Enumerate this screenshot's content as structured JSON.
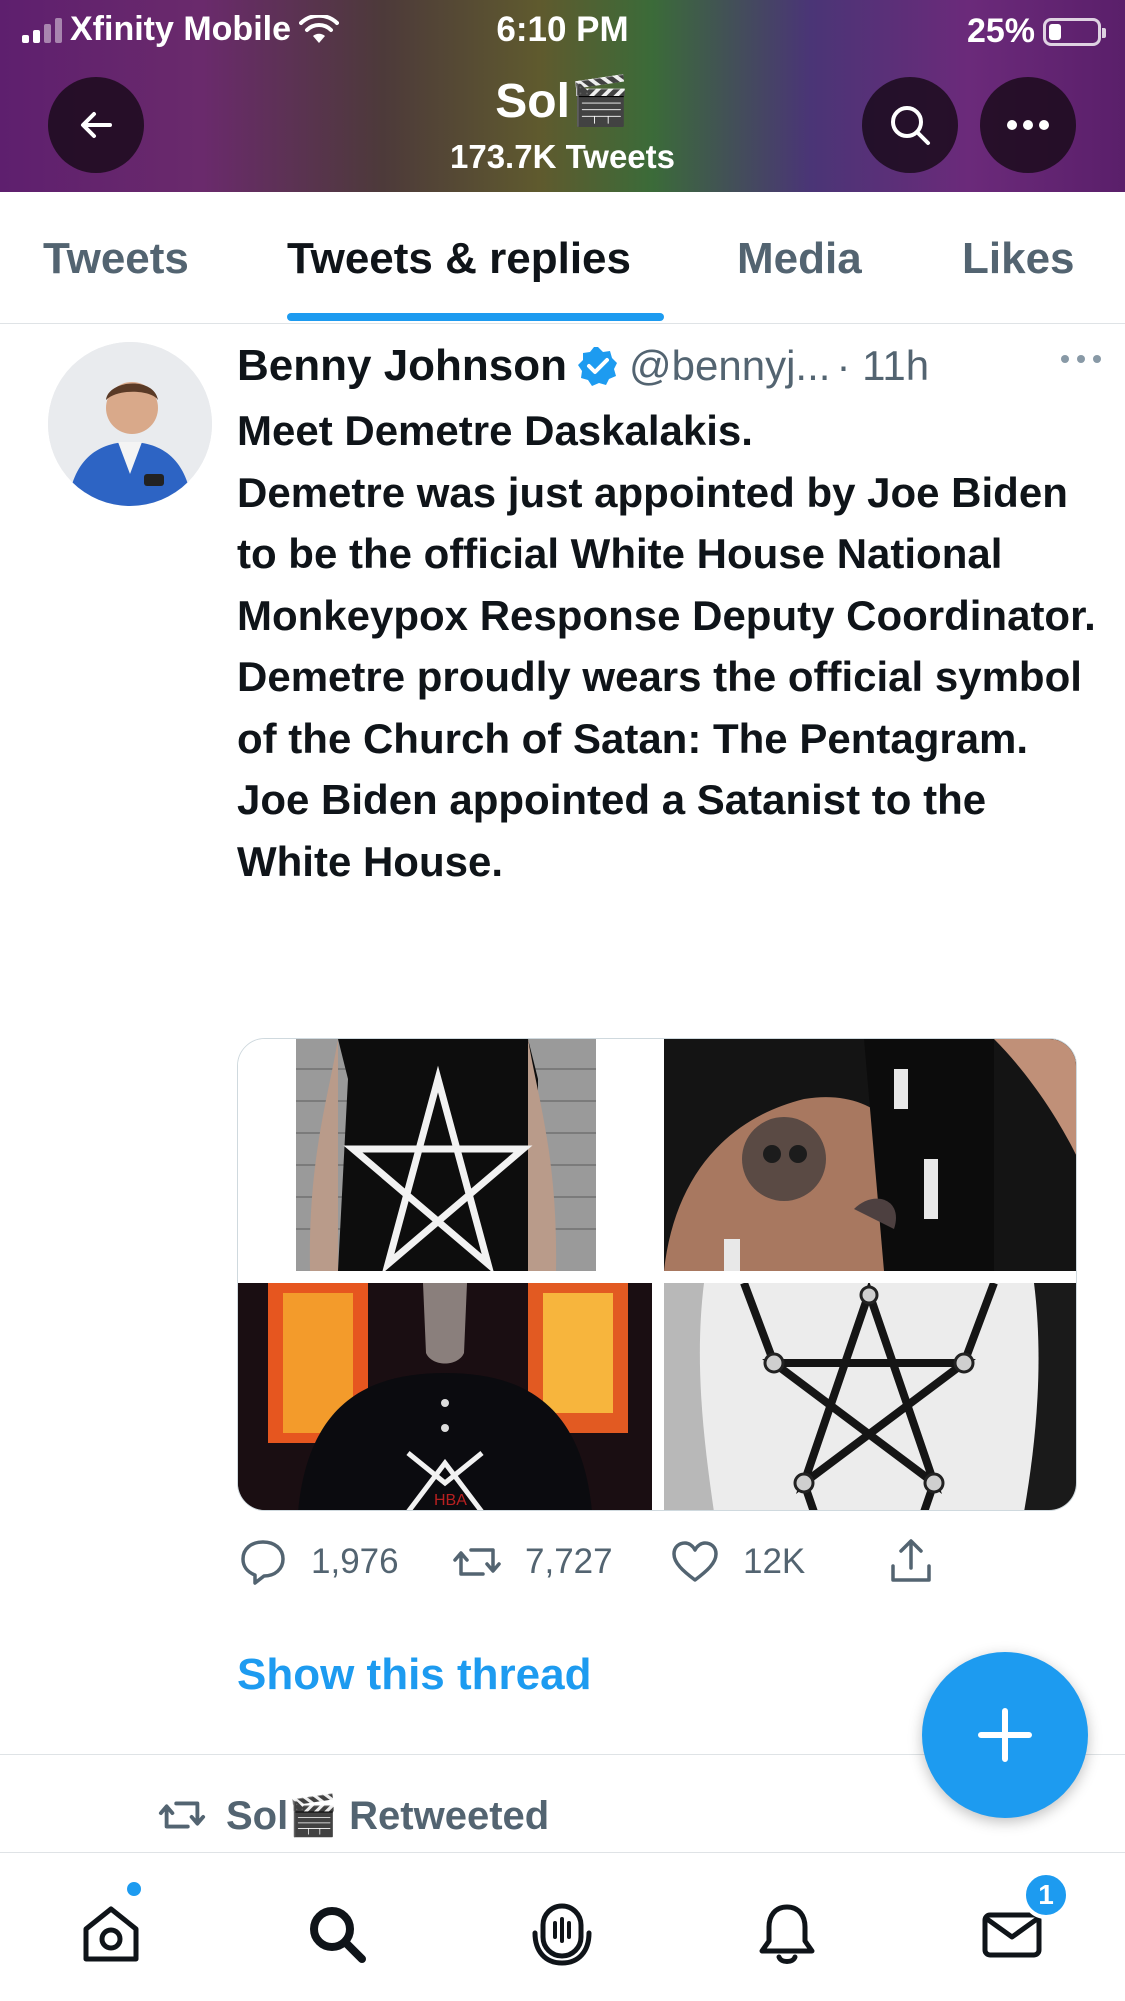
{
  "status_bar": {
    "carrier": "Xfinity Mobile",
    "time": "6:10 PM",
    "battery": "25%",
    "battery_level": 0.25
  },
  "header": {
    "name": "Sol🎬",
    "tweet_count": "173.7K Tweets",
    "back_icon": "arrow-left-icon",
    "search_icon": "search-icon",
    "more_icon": "more-horizontal-icon"
  },
  "tabs": [
    {
      "label": "Tweets",
      "active": false
    },
    {
      "label": "Tweets & replies",
      "active": true
    },
    {
      "label": "Media",
      "active": false
    },
    {
      "label": "Likes",
      "active": false
    }
  ],
  "tweet": {
    "author": "Benny Johnson",
    "handle": "@bennyj...",
    "time": "· 11h",
    "verified": true,
    "text_lines": [
      "Meet Demetre Daskalakis.",
      "Demetre was just appointed by Joe Biden to be the official White House National Monkeypox Response Deputy Coordinator. Demetre proudly wears the official symbol of the Church of Satan: The Pentagram.",
      "Joe Biden appointed a Satanist to the White House."
    ],
    "media_count": 4,
    "stats": {
      "replies": "1,976",
      "retweets": "7,727",
      "likes": "12K"
    },
    "show_thread": "Show this thread"
  },
  "next_item": {
    "retweeted_by": "Sol🎬 Retweeted"
  },
  "bottom_nav": {
    "items": [
      "home-icon",
      "search-icon",
      "spaces-icon",
      "notifications-icon",
      "messages-icon"
    ],
    "messages_badge": "1"
  },
  "colors": {
    "accent": "#1d9bf0",
    "text_primary": "#0f1419",
    "text_secondary": "#536471"
  }
}
